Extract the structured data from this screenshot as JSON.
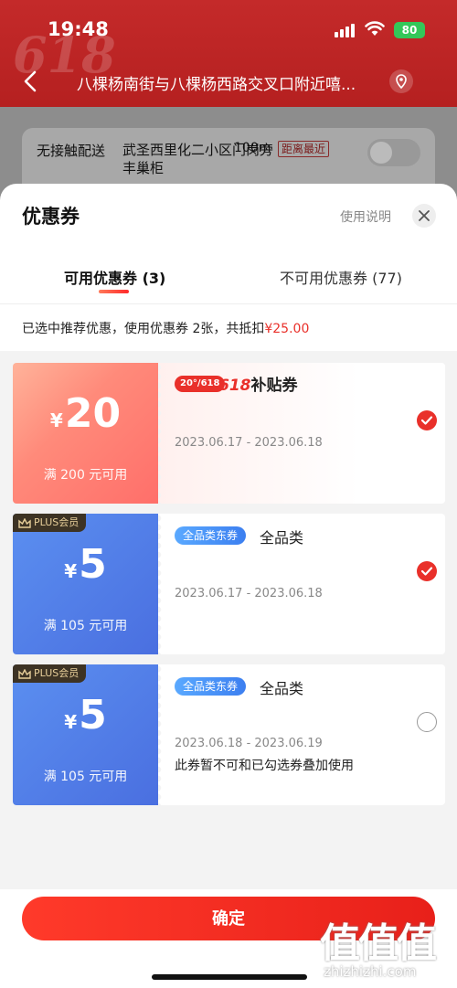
{
  "status_bar": {
    "time": "19:48",
    "battery": "80"
  },
  "background": {
    "brand_mark": "618",
    "address": "八棵杨南街与八棵杨西路交叉口附近嘻...",
    "delivery": {
      "label": "无接触配送",
      "shop": "武圣西里化二小区门岗旁丰巢柜",
      "distance": "100m",
      "tag": "距离最近"
    }
  },
  "sheet": {
    "title": "优惠券",
    "help_label": "使用说明",
    "tabs": [
      {
        "label": "可用优惠券 (3)",
        "active": true
      },
      {
        "label": "不可用优惠券 (77)",
        "active": false
      }
    ],
    "summary": {
      "text": "已选中推荐优惠，使用优惠券 2张，共抵扣",
      "amount": "¥25.00"
    }
  },
  "coupons": [
    {
      "currency": "¥",
      "value": "20",
      "condition": "满 200 元可用",
      "tag": "20°/618",
      "title_num": "618",
      "title_text": "补贴券",
      "date": "2023.06.17 - 2023.06.18",
      "selected": true
    },
    {
      "badge": "PLUS会员",
      "currency": "¥",
      "value": "5",
      "condition": "满 105 元可用",
      "tag": "全品类东券",
      "category": "全品类",
      "date": "2023.06.17 - 2023.06.18",
      "selected": true
    },
    {
      "badge": "PLUS会员",
      "currency": "¥",
      "value": "5",
      "condition": "满 105 元可用",
      "tag": "全品类东券",
      "category": "全品类",
      "date": "2023.06.18 - 2023.06.19",
      "note": "此券暂不可和已勾选券叠加使用",
      "selected": false
    }
  ],
  "footer": {
    "confirm_label": "确定"
  },
  "watermark": {
    "big": "值值值",
    "small": "zhizhizhi.com"
  },
  "colors": {
    "accent": "#e9302a",
    "plus_blue": "#4a6fe0",
    "coupon_pink": "#ff8a7a"
  }
}
